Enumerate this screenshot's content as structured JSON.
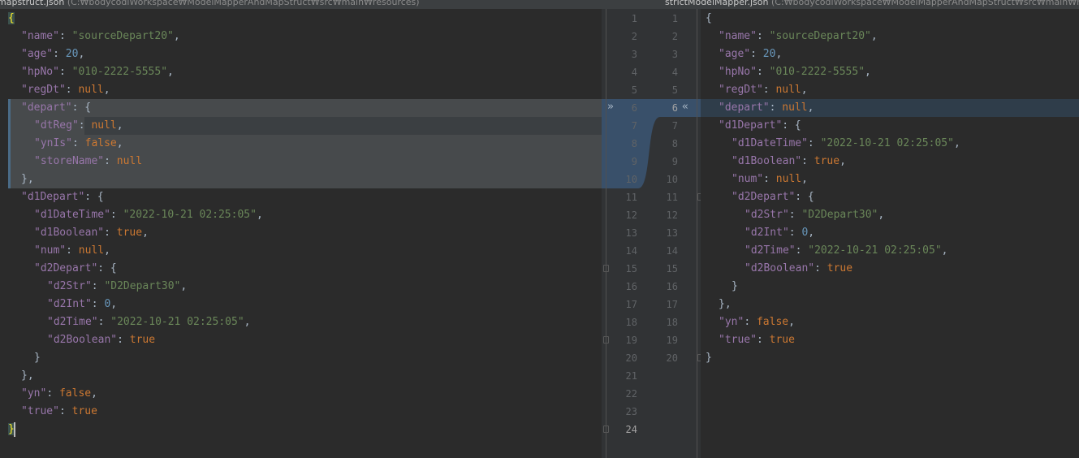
{
  "left_header": {
    "file_name": "mapstruct.json",
    "file_path": "(C:₩bodycodiWorkspace₩ModelMapperAndMapStruct₩src₩main₩resources)"
  },
  "right_header": {
    "file_name": "strictModelMapper.json",
    "file_path": "(C:₩bodycodiWorkspace₩ModelMapperAndMapStruct₩src₩main₩reso"
  },
  "left_lines": [
    [
      [
        "p",
        "{"
      ]
    ],
    [
      [
        "k",
        "\"name\""
      ],
      [
        "p",
        ": "
      ],
      [
        "s",
        "\"sourceDepart20\""
      ],
      [
        "p",
        ","
      ]
    ],
    [
      [
        "k",
        "\"age\""
      ],
      [
        "p",
        ": "
      ],
      [
        "n",
        "20"
      ],
      [
        "p",
        ","
      ]
    ],
    [
      [
        "k",
        "\"hpNo\""
      ],
      [
        "p",
        ": "
      ],
      [
        "s",
        "\"010-2222-5555\""
      ],
      [
        "p",
        ","
      ]
    ],
    [
      [
        "k",
        "\"regDt\""
      ],
      [
        "p",
        ": "
      ],
      [
        "kw",
        "null"
      ],
      [
        "p",
        ","
      ]
    ],
    [
      [
        "k",
        "\"depart\""
      ],
      [
        "p",
        ": {"
      ]
    ],
    [
      [
        "k",
        "\"dtReg\""
      ],
      [
        "p",
        ": "
      ],
      [
        "kw",
        "null"
      ],
      [
        "p",
        ","
      ]
    ],
    [
      [
        "k",
        "\"ynIs\""
      ],
      [
        "p",
        ": "
      ],
      [
        "kw",
        "false"
      ],
      [
        "p",
        ","
      ]
    ],
    [
      [
        "k",
        "\"storeName\""
      ],
      [
        "p",
        ": "
      ],
      [
        "kw",
        "null"
      ]
    ],
    [
      [
        "p",
        "},"
      ]
    ],
    [
      [
        "k",
        "\"d1Depart\""
      ],
      [
        "p",
        ": {"
      ]
    ],
    [
      [
        "k",
        "\"d1DateTime\""
      ],
      [
        "p",
        ": "
      ],
      [
        "s",
        "\"2022-10-21 02:25:05\""
      ],
      [
        "p",
        ","
      ]
    ],
    [
      [
        "k",
        "\"d1Boolean\""
      ],
      [
        "p",
        ": "
      ],
      [
        "kw",
        "true"
      ],
      [
        "p",
        ","
      ]
    ],
    [
      [
        "k",
        "\"num\""
      ],
      [
        "p",
        ": "
      ],
      [
        "kw",
        "null"
      ],
      [
        "p",
        ","
      ]
    ],
    [
      [
        "k",
        "\"d2Depart\""
      ],
      [
        "p",
        ": {"
      ]
    ],
    [
      [
        "k",
        "\"d2Str\""
      ],
      [
        "p",
        ": "
      ],
      [
        "s",
        "\"D2Depart30\""
      ],
      [
        "p",
        ","
      ]
    ],
    [
      [
        "k",
        "\"d2Int\""
      ],
      [
        "p",
        ": "
      ],
      [
        "n",
        "0"
      ],
      [
        "p",
        ","
      ]
    ],
    [
      [
        "k",
        "\"d2Time\""
      ],
      [
        "p",
        ": "
      ],
      [
        "s",
        "\"2022-10-21 02:25:05\""
      ],
      [
        "p",
        ","
      ]
    ],
    [
      [
        "k",
        "\"d2Boolean\""
      ],
      [
        "p",
        ": "
      ],
      [
        "kw",
        "true"
      ]
    ],
    [
      [
        "p",
        "}"
      ]
    ],
    [
      [
        "p",
        "},"
      ]
    ],
    [
      [
        "k",
        "\"yn\""
      ],
      [
        "p",
        ": "
      ],
      [
        "kw",
        "false"
      ],
      [
        "p",
        ","
      ]
    ],
    [
      [
        "k",
        "\"true\""
      ],
      [
        "p",
        ": "
      ],
      [
        "kw",
        "true"
      ]
    ],
    [
      [
        "p",
        "}"
      ]
    ]
  ],
  "right_lines": [
    [
      [
        "p",
        "{"
      ]
    ],
    [
      [
        "k",
        "\"name\""
      ],
      [
        "p",
        ": "
      ],
      [
        "s",
        "\"sourceDepart20\""
      ],
      [
        "p",
        ","
      ]
    ],
    [
      [
        "k",
        "\"age\""
      ],
      [
        "p",
        ": "
      ],
      [
        "n",
        "20"
      ],
      [
        "p",
        ","
      ]
    ],
    [
      [
        "k",
        "\"hpNo\""
      ],
      [
        "p",
        ": "
      ],
      [
        "s",
        "\"010-2222-5555\""
      ],
      [
        "p",
        ","
      ]
    ],
    [
      [
        "k",
        "\"regDt\""
      ],
      [
        "p",
        ": "
      ],
      [
        "kw",
        "null"
      ],
      [
        "p",
        ","
      ]
    ],
    [
      [
        "k",
        "\"depart\""
      ],
      [
        "p",
        ": "
      ],
      [
        "kw",
        "null"
      ],
      [
        "p",
        ","
      ]
    ],
    [
      [
        "k",
        "\"d1Depart\""
      ],
      [
        "p",
        ": {"
      ]
    ],
    [
      [
        "k",
        "\"d1DateTime\""
      ],
      [
        "p",
        ": "
      ],
      [
        "s",
        "\"2022-10-21 02:25:05\""
      ],
      [
        "p",
        ","
      ]
    ],
    [
      [
        "k",
        "\"d1Boolean\""
      ],
      [
        "p",
        ": "
      ],
      [
        "kw",
        "true"
      ],
      [
        "p",
        ","
      ]
    ],
    [
      [
        "k",
        "\"num\""
      ],
      [
        "p",
        ": "
      ],
      [
        "kw",
        "null"
      ],
      [
        "p",
        ","
      ]
    ],
    [
      [
        "k",
        "\"d2Depart\""
      ],
      [
        "p",
        ": {"
      ]
    ],
    [
      [
        "k",
        "\"d2Str\""
      ],
      [
        "p",
        ": "
      ],
      [
        "s",
        "\"D2Depart30\""
      ],
      [
        "p",
        ","
      ]
    ],
    [
      [
        "k",
        "\"d2Int\""
      ],
      [
        "p",
        ": "
      ],
      [
        "n",
        "0"
      ],
      [
        "p",
        ","
      ]
    ],
    [
      [
        "k",
        "\"d2Time\""
      ],
      [
        "p",
        ": "
      ],
      [
        "s",
        "\"2022-10-21 02:25:05\""
      ],
      [
        "p",
        ","
      ]
    ],
    [
      [
        "k",
        "\"d2Boolean\""
      ],
      [
        "p",
        ": "
      ],
      [
        "kw",
        "true"
      ]
    ],
    [
      [
        "p",
        "}"
      ]
    ],
    [
      [
        "p",
        "},"
      ]
    ],
    [
      [
        "k",
        "\"yn\""
      ],
      [
        "p",
        ": "
      ],
      [
        "kw",
        "false"
      ],
      [
        "p",
        ","
      ]
    ],
    [
      [
        "k",
        "\"true\""
      ],
      [
        "p",
        ": "
      ],
      [
        "kw",
        "true"
      ]
    ],
    [
      [
        "p",
        "}"
      ]
    ]
  ],
  "left_line_numbers": [
    "1",
    "2",
    "3",
    "4",
    "5",
    "6",
    "7",
    "8",
    "9",
    "10",
    "11",
    "12",
    "13",
    "14",
    "15",
    "16",
    "17",
    "18",
    "19",
    "20",
    "21",
    "22",
    "23",
    "24"
  ],
  "right_line_numbers": [
    "1",
    "2",
    "3",
    "4",
    "5",
    "6",
    "7",
    "8",
    "9",
    "10",
    "11",
    "12",
    "13",
    "14",
    "15",
    "16",
    "17",
    "18",
    "19",
    "20"
  ],
  "diff": {
    "apply_left_icon": "double-chevron-right-icon",
    "apply_right_icon": "double-chevron-left-icon",
    "apply_left_glyph": "»",
    "apply_right_glyph": "«"
  },
  "colors": {
    "background": "#2b2b2b",
    "changed_block": "#474a4c",
    "modified_line": "#2f3d4a",
    "diff_connector": "#39506a",
    "key": "#9876aa",
    "string": "#6a8759",
    "number": "#6897bb",
    "keyword": "#cc7832"
  }
}
